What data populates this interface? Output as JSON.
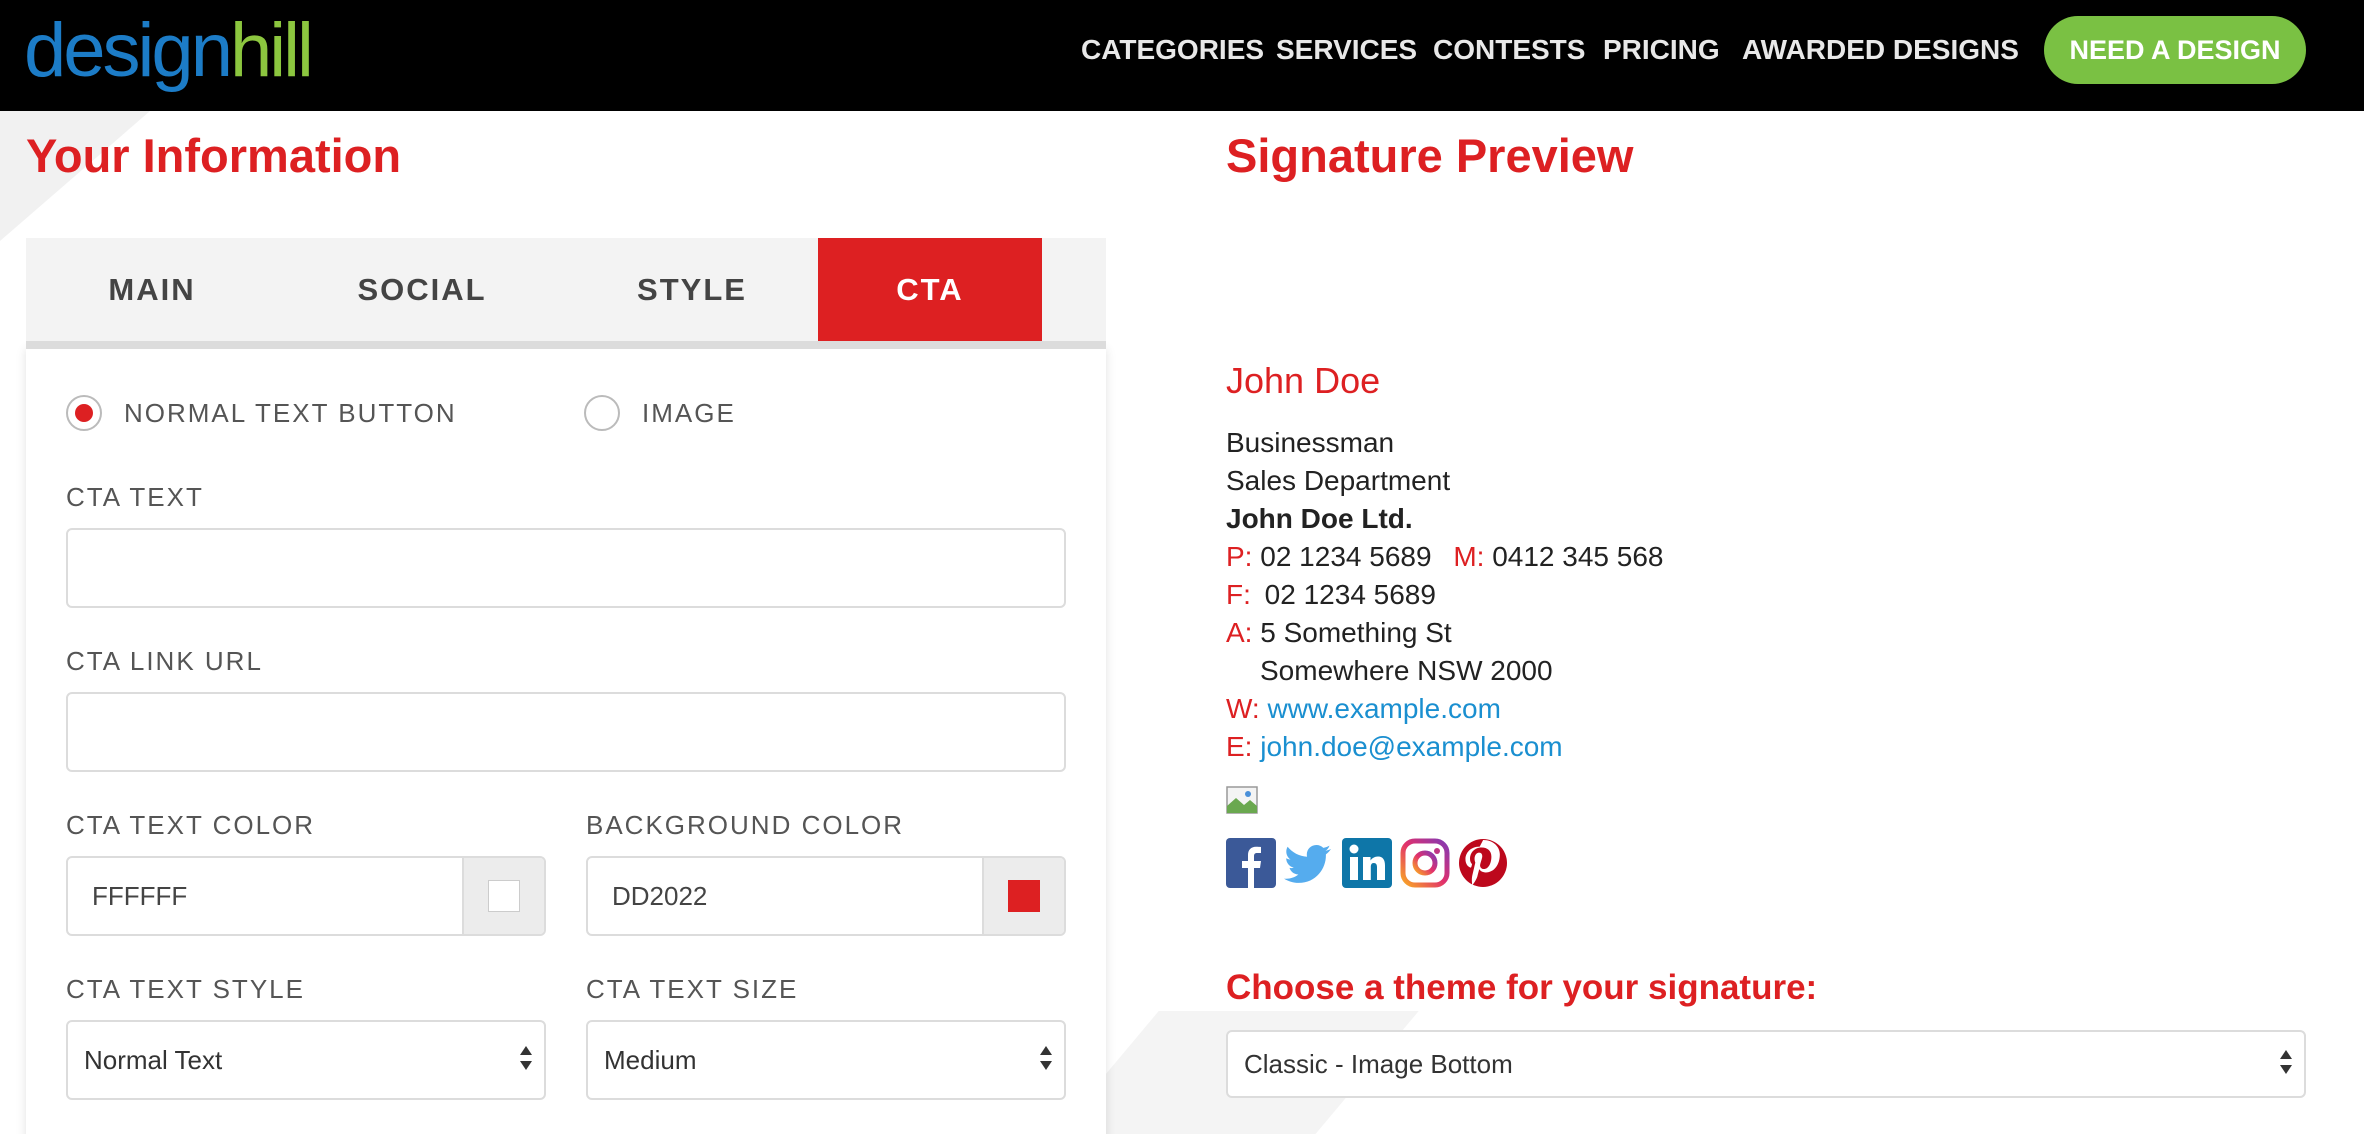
{
  "header": {
    "logo_part1": "design",
    "logo_part2": "hill",
    "nav": [
      "CATEGORIES",
      "SERVICES",
      "CONTESTS",
      "PRICING",
      "AWARDED DESIGNS"
    ],
    "cta_label": "NEED A DESIGN"
  },
  "left": {
    "title": "Your Information",
    "tabs": [
      "MAIN",
      "SOCIAL",
      "STYLE",
      "CTA"
    ],
    "active_tab": "CTA",
    "radio_normal": "NORMAL TEXT BUTTON",
    "radio_image": "IMAGE",
    "cta_text_label": "CTA TEXT",
    "cta_text_value": "",
    "cta_link_label": "CTA LINK URL",
    "cta_link_value": "",
    "text_color_label": "CTA TEXT COLOR",
    "text_color_value": "FFFFFF",
    "bg_color_label": "BACKGROUND COLOR",
    "bg_color_value": "DD2022",
    "text_style_label": "CTA TEXT STYLE",
    "text_style_value": "Normal Text",
    "text_size_label": "CTA TEXT SIZE",
    "text_size_value": "Medium"
  },
  "right": {
    "title": "Signature Preview",
    "name": "John Doe",
    "job_title": "Businessman",
    "department": "Sales Department",
    "company": "John Doe Ltd.",
    "phone_key": "P:",
    "phone": "02 1234 5689",
    "mobile_key": "M:",
    "mobile": "0412 345 568",
    "fax_key": "F:",
    "fax": "02 1234 5689",
    "address_key": "A:",
    "address1": "5 Something St",
    "address2": "Somewhere NSW 2000",
    "web_key": "W:",
    "web": "www.example.com",
    "email_key": "E:",
    "email": "john.doe@example.com",
    "social_icons": [
      "facebook-icon",
      "twitter-icon",
      "linkedin-icon",
      "instagram-icon",
      "pinterest-icon"
    ],
    "theme_label": "Choose a theme for your signature:",
    "theme_value": "Classic - Image Bottom"
  },
  "colors": {
    "accent": "#dd2022",
    "green": "#7ac143",
    "link": "#1a8fd0"
  }
}
